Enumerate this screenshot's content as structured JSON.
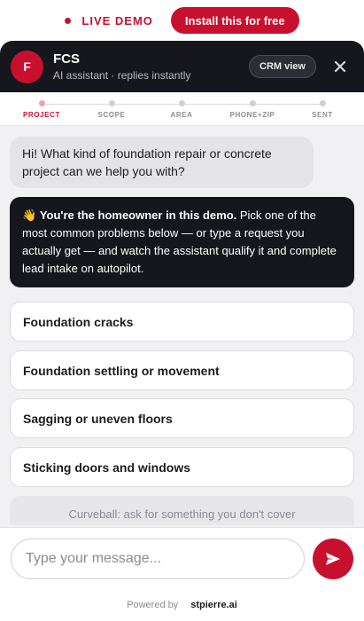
{
  "topbar": {
    "live_label": "LIVE DEMO",
    "install_label": "Install this for free"
  },
  "header": {
    "avatar_letter": "F",
    "brand": "FCS",
    "subtitle": "AI assistant · replies instantly",
    "crm_label": "CRM view",
    "close_icon": "close-icon"
  },
  "steps": [
    {
      "label": "PROJECT",
      "active": true
    },
    {
      "label": "SCOPE",
      "active": false
    },
    {
      "label": "AREA",
      "active": false
    },
    {
      "label": "PHONE+ZIP",
      "active": false
    },
    {
      "label": "SENT",
      "active": false
    }
  ],
  "messages": {
    "greeting": "Hi! What kind of foundation repair or concrete project can we help you with?",
    "note_emoji": "👋",
    "note_bold": "You're the homeowner in this demo.",
    "note_text": " Pick one of the most common problems below — or type a request you actually get — and watch the assistant qualify it and complete lead intake on autopilot."
  },
  "options": [
    "Foundation cracks",
    "Foundation settling or movement",
    "Sagging or uneven floors",
    "Sticking doors and windows"
  ],
  "curveball": "Curveball: ask for something you don't cover",
  "composer": {
    "placeholder": "Type your message...",
    "send_icon": "send-icon"
  },
  "footer": {
    "powered_by": "Powered by",
    "brand": "stpierre.ai"
  },
  "colors": {
    "accent": "#c8102e",
    "header_bg": "#15171c",
    "panel_bg": "#f1f1f3"
  }
}
